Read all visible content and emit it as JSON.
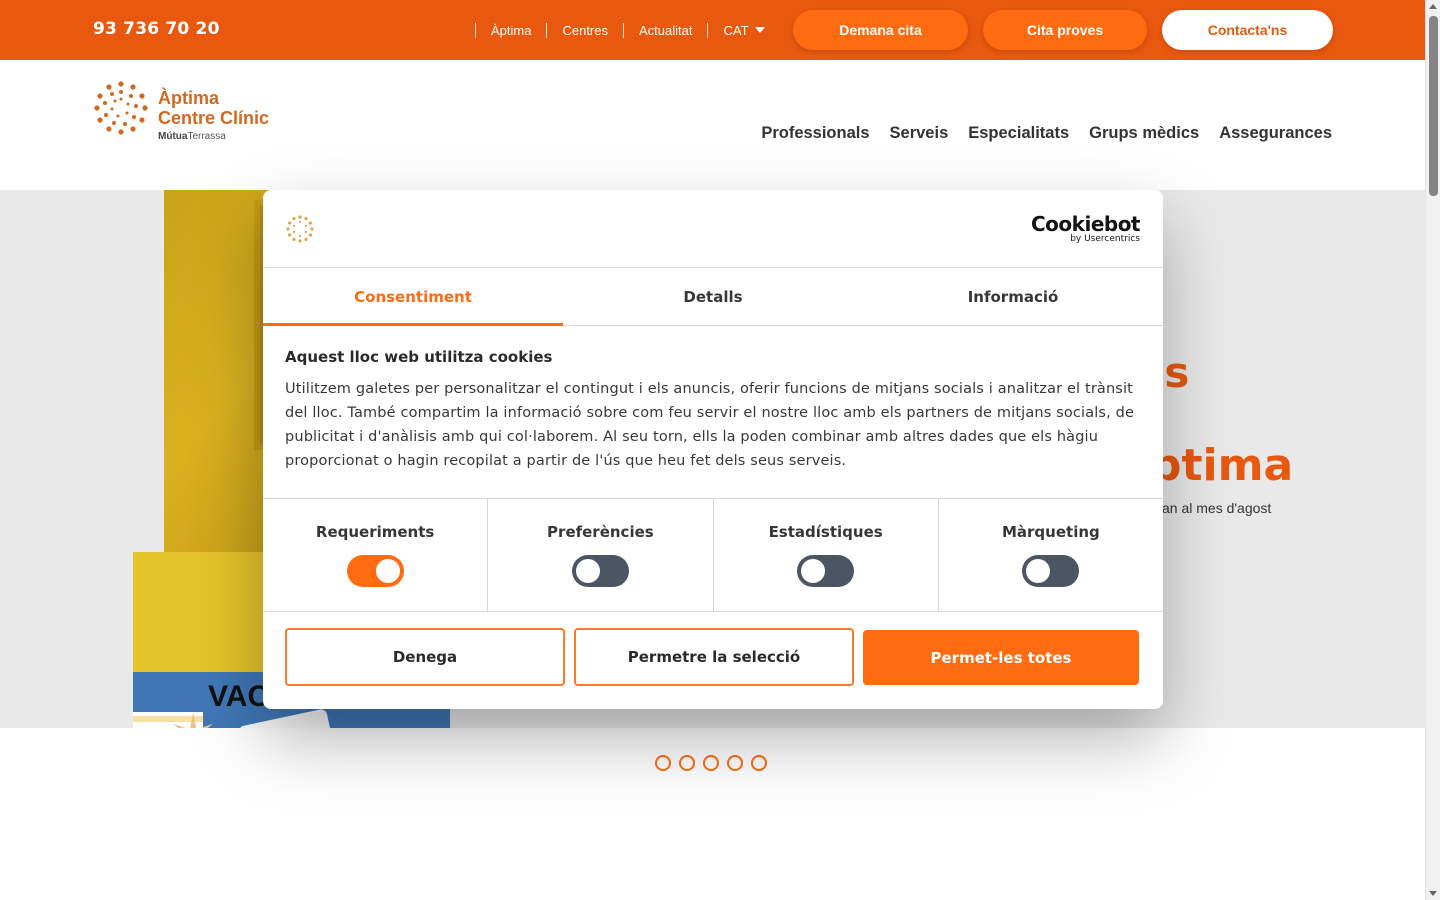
{
  "topbar": {
    "phone": "93 736 70 20",
    "links": [
      "Àptima",
      "Centres",
      "Actualitat"
    ],
    "lang": "CAT",
    "buttons": {
      "appointment": "Demana cita",
      "tests": "Cita proves",
      "contact": "Contacta'ns"
    }
  },
  "logo": {
    "line1": "Àptima",
    "line2": "Centre Clínic",
    "line3_bold": "Mútua",
    "line3": "Terrassa"
  },
  "nav": [
    "Professionals",
    "Serveis",
    "Especialitats",
    "Grups mèdics",
    "Assegurances"
  ],
  "hero": {
    "big1": "is",
    "big2": "ptima",
    "sub": "an al mes d'agost",
    "photo_text": "VAC",
    "slides": 5
  },
  "cookie": {
    "brand": "Cookiebot",
    "brand_sub": "by Usercentrics",
    "tabs": [
      "Consentiment",
      "Detalls",
      "Informació"
    ],
    "title": "Aquest lloc web utilitza cookies",
    "text": "Utilitzem galetes per personalitzar el contingut i els anuncis, oferir funcions de mitjans socials i analitzar el trànsit del lloc. També compartim la informació sobre com feu servir el nostre lloc amb els partners de mitjans socials, de publicitat i d'anàlisis amb qui col·laborem. Al seu torn, ells la poden combinar amb altres dades que els hàgiu proporcionat o hagin recopilat a partir de l'ús que heu fet dels seus serveis.",
    "categories": [
      {
        "label": "Requeriments",
        "on": true
      },
      {
        "label": "Preferències",
        "on": false
      },
      {
        "label": "Estadístiques",
        "on": false
      },
      {
        "label": "Màrqueting",
        "on": false
      }
    ],
    "buttons": {
      "deny": "Denega",
      "selection": "Permetre la selecció",
      "all": "Permet-les totes"
    }
  },
  "colors": {
    "brand_orange": "#e8580f",
    "accent_orange": "#ff6b10",
    "toggle_off": "#4b5563"
  }
}
